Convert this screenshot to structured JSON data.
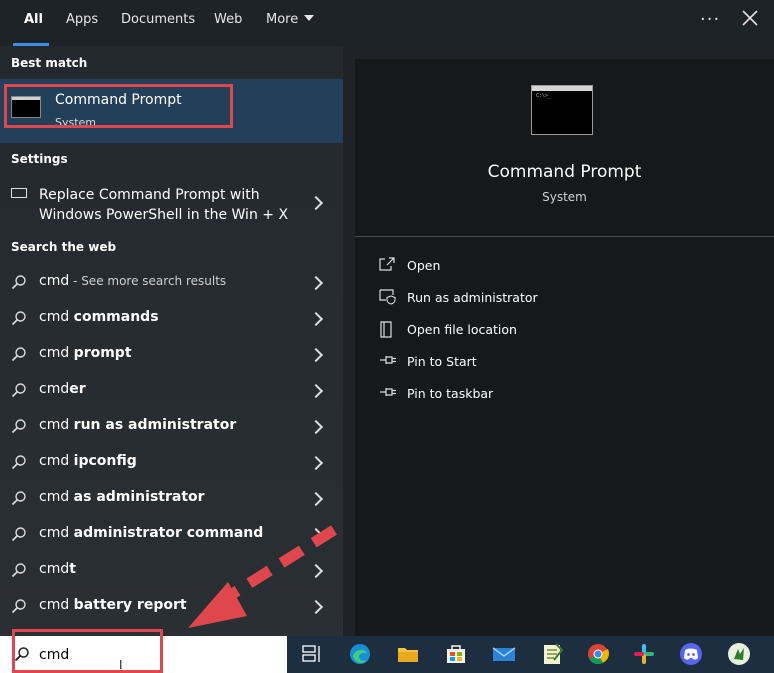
{
  "tabs": [
    {
      "label": "All"
    },
    {
      "label": "Apps"
    },
    {
      "label": "Documents"
    },
    {
      "label": "Web"
    },
    {
      "label": "More"
    }
  ],
  "sections": {
    "best_match": "Best match",
    "settings": "Settings",
    "search_web": "Search the web"
  },
  "best_match": {
    "title": "Command Prompt",
    "subtitle": "System"
  },
  "settings_item": {
    "line1": "Replace Command Prompt with",
    "line2": "Windows PowerShell in the Win + X"
  },
  "web_results": [
    {
      "prefix": "cmd",
      "bold": "",
      "hint": " - See more search results"
    },
    {
      "prefix": "cmd ",
      "bold": "commands",
      "hint": ""
    },
    {
      "prefix": "cmd ",
      "bold": "prompt",
      "hint": ""
    },
    {
      "prefix": "cmd",
      "bold": "er",
      "hint": ""
    },
    {
      "prefix": "cmd ",
      "bold": "run as administrator",
      "hint": ""
    },
    {
      "prefix": "cmd ",
      "bold": "ipconfig",
      "hint": ""
    },
    {
      "prefix": "cmd ",
      "bold": "as administrator",
      "hint": ""
    },
    {
      "prefix": "cmd ",
      "bold": "administrator command",
      "hint": ""
    },
    {
      "prefix": "cmd",
      "bold": "t",
      "hint": ""
    },
    {
      "prefix": "cmd ",
      "bold": "battery report",
      "hint": ""
    }
  ],
  "preview": {
    "title": "Command Prompt",
    "subtitle": "System",
    "actions": [
      {
        "label": "Open",
        "icon": "open-icon"
      },
      {
        "label": "Run as administrator",
        "icon": "shield-icon"
      },
      {
        "label": "Open file location",
        "icon": "file-location-icon"
      },
      {
        "label": "Pin to Start",
        "icon": "pin-icon"
      },
      {
        "label": "Pin to taskbar",
        "icon": "pin-icon"
      }
    ]
  },
  "search": {
    "value": "cmd"
  },
  "colors": {
    "accent": "#3a8ee6",
    "highlight": "#e0474c",
    "selection": "#23405a"
  },
  "taskbar_icons": [
    "task-view-icon",
    "edge-icon",
    "file-explorer-icon",
    "store-icon",
    "mail-icon",
    "notepad-icon",
    "chrome-icon",
    "slack-icon",
    "discord-icon",
    "app-icon"
  ]
}
